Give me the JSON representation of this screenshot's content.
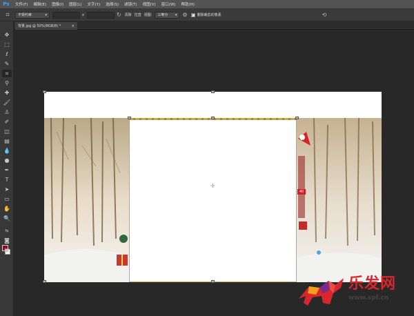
{
  "app": {
    "logo": "Ps"
  },
  "menu": [
    "文件(F)",
    "编辑(E)",
    "图像(I)",
    "图层(L)",
    "文字(Y)",
    "选择(S)",
    "滤镜(T)",
    "视图(V)",
    "窗口(W)",
    "帮助(H)"
  ],
  "options": {
    "ratio_select": "不受约束",
    "swap_symbol": "x",
    "clear_label": "清除",
    "straighten_label": "拉直",
    "view_label": "视图:",
    "view_select": "三等分",
    "delete_pixels_label": "删除裁剪的像素",
    "delete_pixels_checked": true
  },
  "document": {
    "tab_title": "背景.jpg @ 50%(RGB/8) *",
    "close_symbol": "×"
  },
  "colors": {
    "foreground": "#8b0d2a",
    "background": "#ffffff",
    "crop_border": "#c9a84a"
  },
  "watermark": {
    "text": "乐发网",
    "url": "www.spf.cn"
  },
  "badges": {
    "number_40": "40"
  }
}
